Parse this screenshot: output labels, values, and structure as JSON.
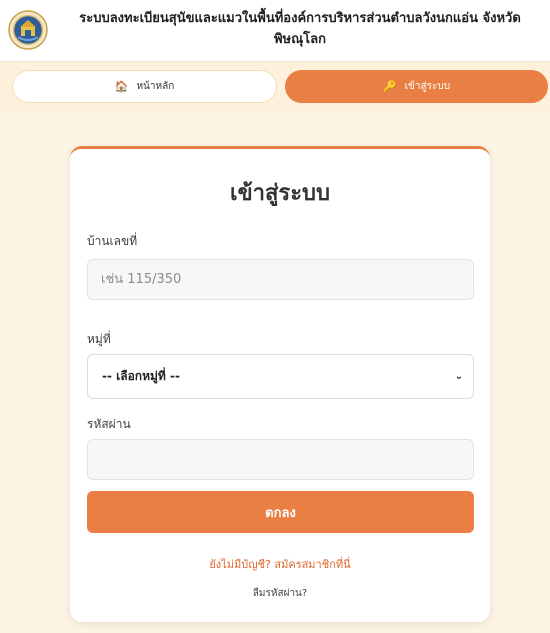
{
  "header": {
    "title": "ระบบลงทะเบียนสุนัขและแมวในพื้นที่องค์การบริหารส่วนตำบลวังนกแอ่น จังหวัดพิษณุโลก"
  },
  "nav": {
    "home_label": "หน้าหลัก",
    "home_icon": "home-icon",
    "login_label": "เข้าสู่ระบบ",
    "login_icon": "key-icon"
  },
  "form": {
    "title": "เข้าสู่ระบบ",
    "house_label": "บ้านเลขที่",
    "house_placeholder": "เช่น 115/350",
    "village_label": "หมู่ที่",
    "village_selected": "-- เลือกหมู่ที่ --",
    "password_label": "รหัสผ่าน",
    "password_value": "",
    "submit_label": "ตกลง",
    "register_link": "ยังไม่มีบัญชี? สมัครสมาชิกที่นี่",
    "forgot_link": "ลืมรหัสผ่าน?"
  },
  "colors": {
    "accent": "#e97f45",
    "background": "#fbf3e3"
  }
}
